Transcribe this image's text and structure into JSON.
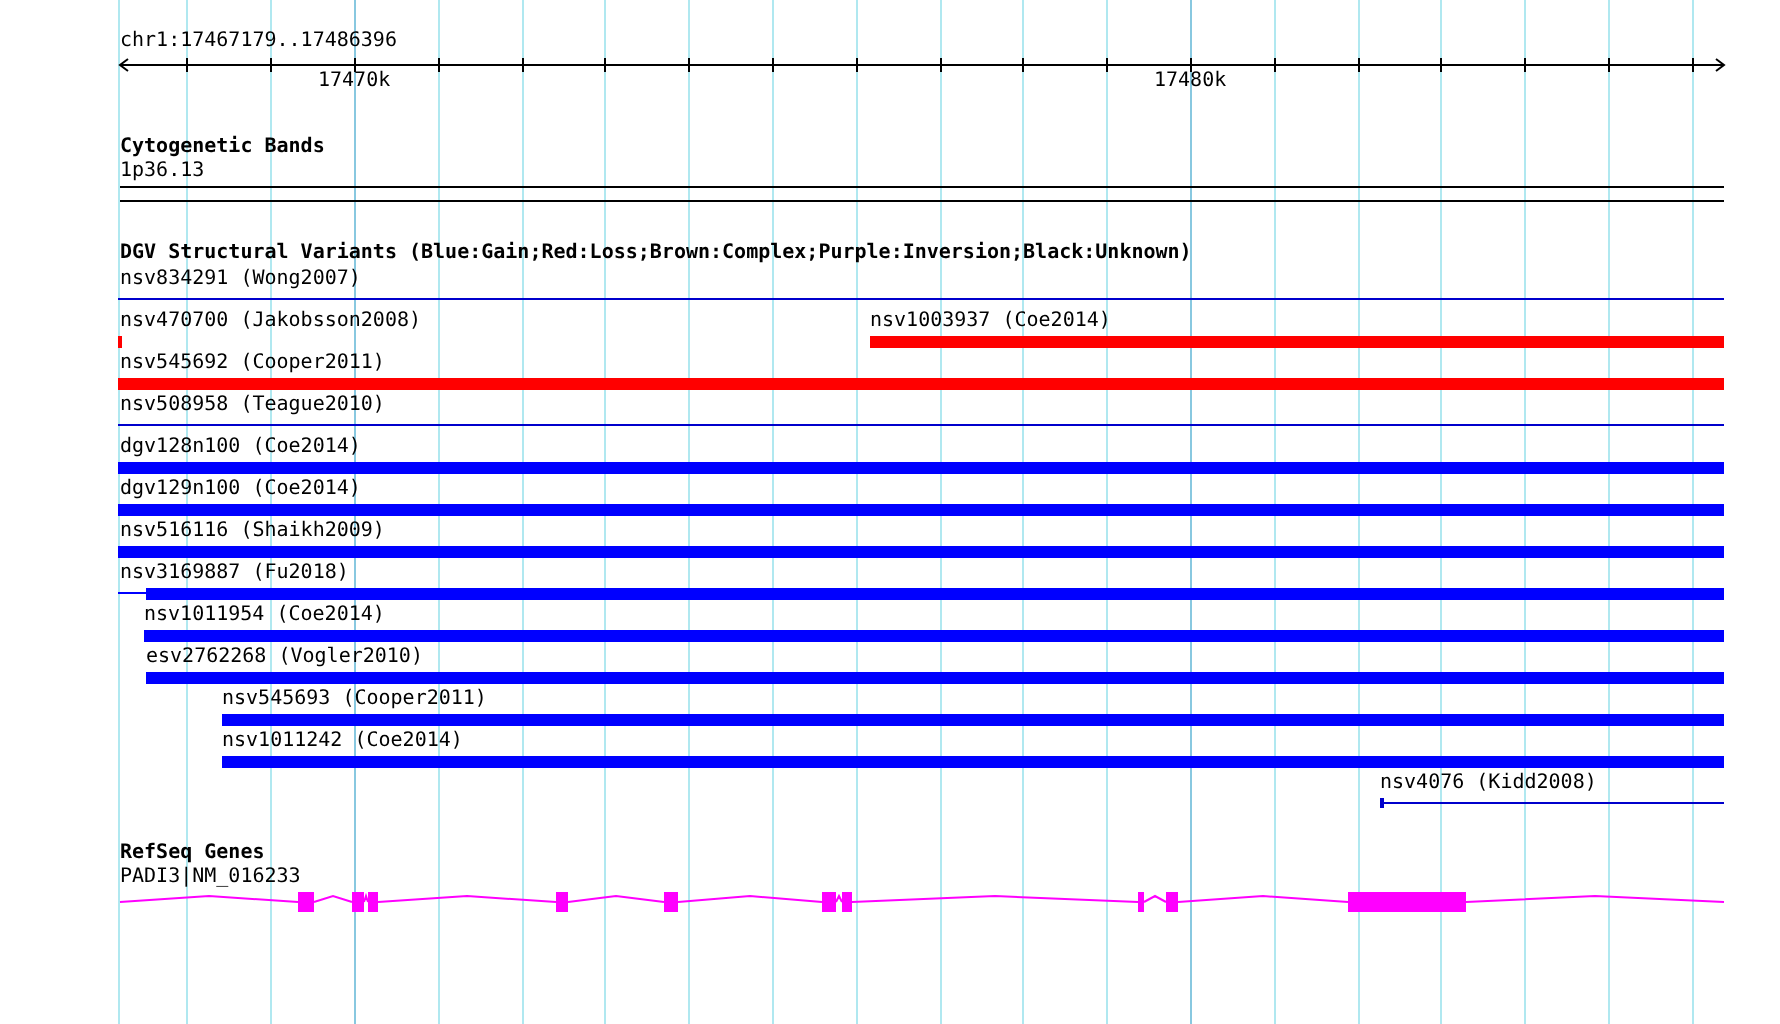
{
  "ruler": {
    "location": "chr1:17467179..17486396",
    "tick_labels": [
      "17470k",
      "17480k"
    ]
  },
  "cytogenetic_bands": {
    "title": "Cytogenetic Bands",
    "band": "1p36.13"
  },
  "dgv_variants": {
    "title": "DGV Structural Variants (Blue:Gain;Red:Loss;Brown:Complex;Purple:Inversion;Black:Unknown)",
    "rows": [
      [
        {
          "label": "nsv834291 (Wong2007)",
          "color": "#0000cc",
          "kind": "line"
        }
      ],
      [
        {
          "label": "nsv470700 (Jakobsson2008)",
          "color": "#ff0000",
          "kind": "bar"
        },
        {
          "label": "nsv1003937 (Coe2014)",
          "color": "#ff0000",
          "kind": "bar"
        }
      ],
      [
        {
          "label": "nsv545692 (Cooper2011)",
          "color": "#ff0000",
          "kind": "bar"
        }
      ],
      [
        {
          "label": "nsv508958 (Teague2010)",
          "color": "#0000cc",
          "kind": "line"
        }
      ],
      [
        {
          "label": "dgv128n100 (Coe2014)",
          "color": "#0000ff",
          "kind": "bar"
        }
      ],
      [
        {
          "label": "dgv129n100 (Coe2014)",
          "color": "#0000ff",
          "kind": "bar"
        }
      ],
      [
        {
          "label": "nsv516116 (Shaikh2009)",
          "color": "#0000ff",
          "kind": "bar"
        }
      ],
      [
        {
          "label": "nsv3169887 (Fu2018)",
          "color": "#0000ff",
          "kind": "bar"
        }
      ],
      [
        {
          "label": "nsv1011954 (Coe2014)",
          "color": "#0000ff",
          "kind": "bar"
        }
      ],
      [
        {
          "label": "esv2762268 (Vogler2010)",
          "color": "#0000ff",
          "kind": "bar"
        }
      ],
      [
        {
          "label": "nsv545693 (Cooper2011)",
          "color": "#0000ff",
          "kind": "bar"
        }
      ],
      [
        {
          "label": "nsv1011242 (Coe2014)",
          "color": "#0000ff",
          "kind": "bar"
        }
      ],
      [
        {
          "label": "nsv4076 (Kidd2008)",
          "color": "#0000cc",
          "kind": "line"
        }
      ]
    ]
  },
  "refseq_genes": {
    "title": "RefSeq Genes",
    "gene": "PADI3|NM_016233"
  }
}
